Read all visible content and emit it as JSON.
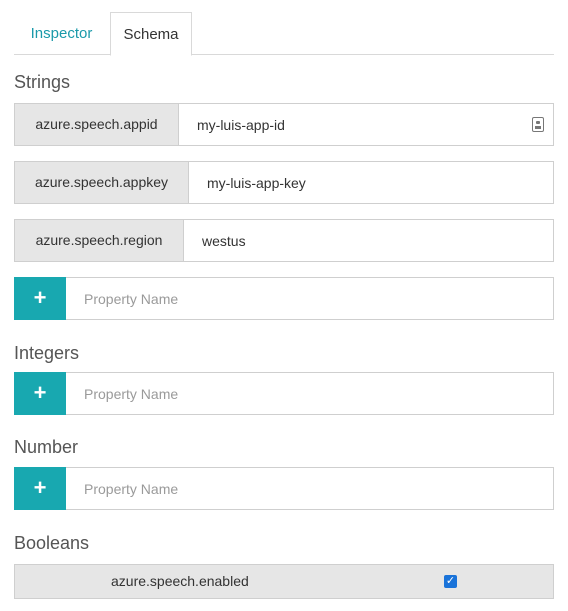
{
  "tabs": [
    {
      "label": "Inspector",
      "active": false
    },
    {
      "label": "Schema",
      "active": true
    }
  ],
  "sections": {
    "strings": {
      "title": "Strings",
      "properties": [
        {
          "key": "azure.speech.appid",
          "value": "my-luis-app-id"
        },
        {
          "key": "azure.speech.appkey",
          "value": "my-luis-app-key"
        },
        {
          "key": "azure.speech.region",
          "value": "westus"
        }
      ],
      "add_placeholder": "Property Name"
    },
    "integers": {
      "title": "Integers",
      "add_placeholder": "Property Name"
    },
    "number": {
      "title": "Number",
      "add_placeholder": "Property Name"
    },
    "booleans": {
      "title": "Booleans",
      "properties": [
        {
          "key": "azure.speech.enabled",
          "checked": true
        }
      ]
    }
  },
  "icons": {
    "add": "plus-icon",
    "field_badge": "id-card-icon",
    "checkbox": "checkmark-icon"
  },
  "colors": {
    "accent": "#18a8b0",
    "tab_active_link": "#1b9aaa",
    "checkbox": "#1a73d9"
  },
  "add_symbol": "+",
  "check_symbol": "✓"
}
